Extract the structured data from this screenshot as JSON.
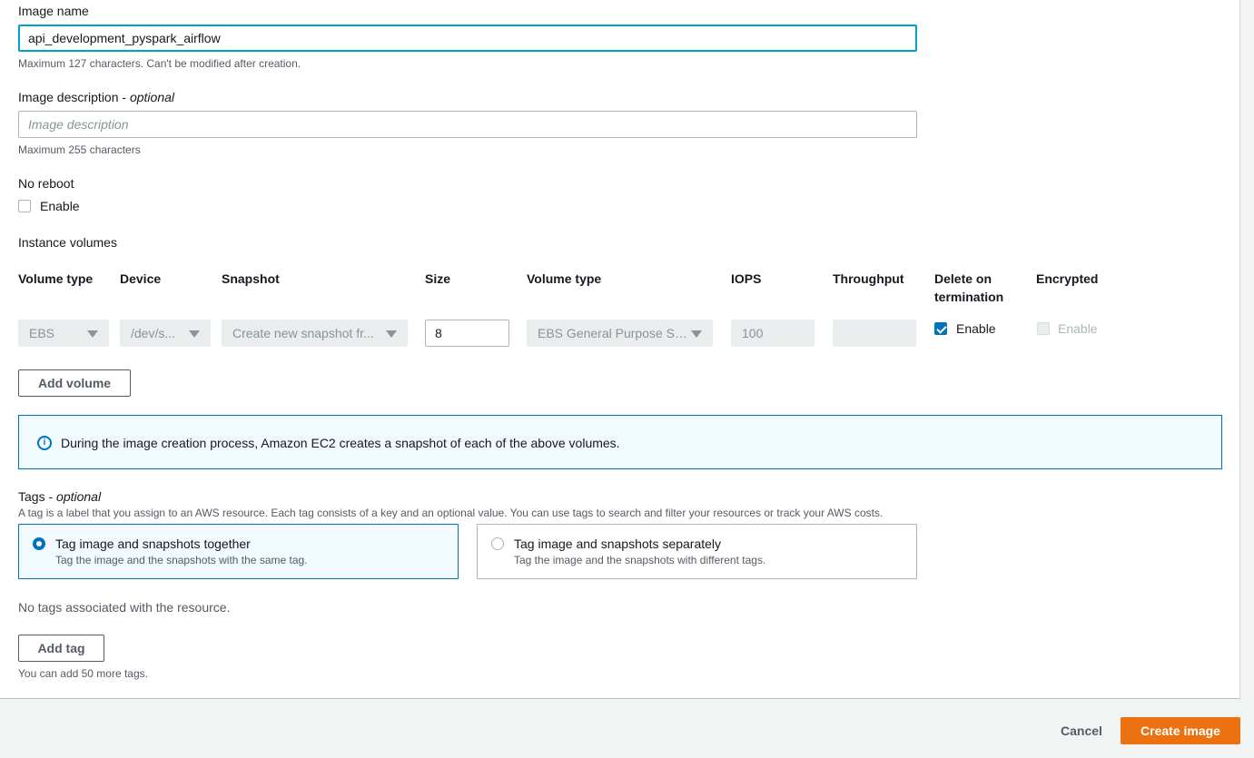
{
  "image_name": {
    "label": "Image name",
    "value": "api_development_pyspark_airflow",
    "hint": "Maximum 127 characters. Can't be modified after creation."
  },
  "image_description": {
    "label": "Image description",
    "optional": "optional",
    "placeholder": "Image description",
    "hint": "Maximum 255 characters"
  },
  "no_reboot": {
    "label": "No reboot",
    "checkbox_label": "Enable",
    "checked": false
  },
  "instance_volumes": {
    "label": "Instance volumes",
    "columns": [
      "Volume type",
      "Device",
      "Snapshot",
      "Size",
      "Volume type",
      "IOPS",
      "Throughput",
      "Delete on termination",
      "Encrypted"
    ],
    "delete_on_termination_lines": [
      "Delete on",
      "termination"
    ],
    "row": {
      "volume_type": "EBS",
      "device": "/dev/s...",
      "snapshot": "Create new snapshot fr...",
      "size": "8",
      "ebs_volume_type": "EBS General Purpose SS...",
      "iops": "100",
      "throughput": "",
      "delete_on_termination": {
        "label": "Enable",
        "checked": true
      },
      "encrypted": {
        "label": "Enable",
        "checked": false,
        "disabled": true
      }
    },
    "add_volume_button": "Add volume"
  },
  "info_alert": {
    "text": "During the image creation process, Amazon EC2 creates a snapshot of each of the above volumes."
  },
  "tags": {
    "label": "Tags",
    "optional": "optional",
    "description": "A tag is a label that you assign to an AWS resource. Each tag consists of a key and an optional value. You can use tags to search and filter your resources or track your AWS costs.",
    "options": [
      {
        "title": "Tag image and snapshots together",
        "subtitle": "Tag the image and the snapshots with the same tag.",
        "selected": true
      },
      {
        "title": "Tag image and snapshots separately",
        "subtitle": "Tag the image and the snapshots with different tags.",
        "selected": false
      }
    ],
    "empty_text": "No tags associated with the resource.",
    "add_tag_button": "Add tag",
    "remaining_hint": "You can add 50 more tags."
  },
  "footer": {
    "cancel_label": "Cancel",
    "create_label": "Create image",
    "primary_color": "#ec7211"
  },
  "accent_color": "#0073bb"
}
